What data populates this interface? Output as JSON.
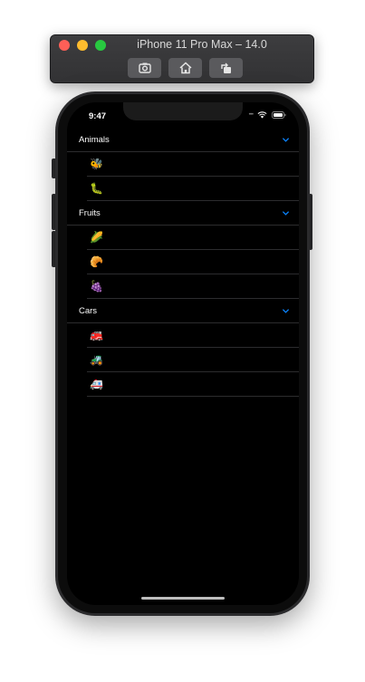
{
  "simulator": {
    "title": "iPhone 11 Pro Max – 14.0",
    "buttons": [
      "screenshot-icon",
      "home-icon",
      "rotate-icon"
    ]
  },
  "status_bar": {
    "time": "9:47",
    "indicators": [
      "cellular-dots-icon",
      "wifi-icon",
      "battery-icon"
    ]
  },
  "sections": [
    {
      "title": "Animals",
      "items": [
        "🐝",
        "🐛"
      ]
    },
    {
      "title": "Fruits",
      "items": [
        "🌽",
        "🥐",
        "🍇"
      ]
    },
    {
      "title": "Cars",
      "items": [
        "🚒",
        "🚜",
        "🚑"
      ]
    }
  ],
  "colors": {
    "accent": "#0a84ff",
    "background": "#000000",
    "separator": "#2c2c2e"
  }
}
